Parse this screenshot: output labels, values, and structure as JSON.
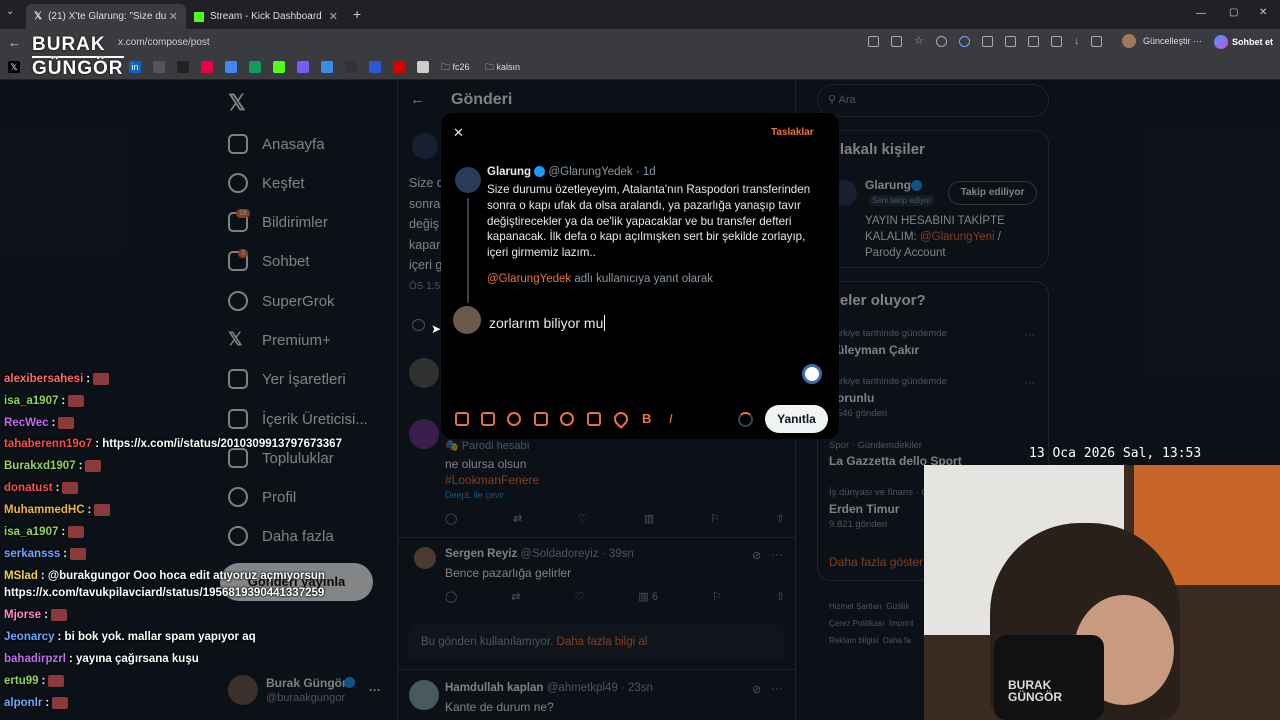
{
  "browser": {
    "tabs": [
      {
        "label": "(21) X'te Glarung: \"Size durumu öz",
        "close": "✕"
      },
      {
        "label": "Stream - Kick Dashboard",
        "close": "✕"
      }
    ],
    "new_tab": "+",
    "url": "x.com/compose/post",
    "update_btn": "Güncelleştir",
    "chat_btn": "Sohbet et",
    "bookmarks": [
      "fc26",
      "kalsın"
    ],
    "window_controls": [
      "—",
      "▢",
      "✕"
    ]
  },
  "overlay_logo": {
    "line1": "BURAK",
    "line2": "GÜNGÖR"
  },
  "x_nav": {
    "items": [
      {
        "label": "Anasayfa"
      },
      {
        "label": "Keşfet"
      },
      {
        "label": "Bildirimler",
        "badge": "18"
      },
      {
        "label": "Sohbet",
        "badge": "3"
      },
      {
        "label": "SuperGrok"
      },
      {
        "label": "Premium+"
      },
      {
        "label": "Yer İşaretleri"
      },
      {
        "label": "İçerik Üreticisi..."
      },
      {
        "label": "Topluluklar"
      },
      {
        "label": "Profil"
      },
      {
        "label": "Daha fazla"
      }
    ],
    "post_button": "Gönderi yayınla",
    "account": {
      "name": "Burak Güngör",
      "handle": "@buraakgungor",
      "more": "···"
    }
  },
  "feed": {
    "header": "Gönderi",
    "bg_text": [
      "Size d",
      "sonra",
      "değiş",
      "kapar",
      "içeri g"
    ],
    "time": "ÖS 1:5",
    "reply1": {
      "badge": "Parodi hesabı",
      "text": "ne olursa olsun",
      "hashtag": "#LookmanFenere",
      "translate": "DeepL ile çevir"
    },
    "reply2": {
      "name": "Sergen Reyiz",
      "handle": "@Soldadoreyiz",
      "time": "· 39sn",
      "text": "Bence pazarlığa gelirler",
      "views": "6"
    },
    "unavailable": "Bu gönderi kullanılamıyor.",
    "unavailable_link": "Daha fazla bilgi al",
    "reply3": {
      "name": "Hamdullah kaplan",
      "handle": "@ahmetkpl49",
      "time": "· 23sn",
      "text": "Kante de durum ne?"
    }
  },
  "modal": {
    "close": "✕",
    "drafts": "Taslaklar",
    "quoted": {
      "name": "Glarung",
      "handle": "@GlarungYedek",
      "time": "· 1d",
      "text": "Size durumu özetleyeyim, Atalanta'nın Raspodori transferinden sonra o kapı ufak da olsa aralandı, ya pazarlığa yanaşıp tavır değiştirecekler ya da oe'lik yapacaklar ve bu transfer defteri kapanacak. İlk defa o kapı açılmışken sert bir şekilde zorlayıp, içeri girmemiz lazım.."
    },
    "replying_to_handle": "@GlarungYedek",
    "replying_to_text": "adlı kullanıcıya yanıt olarak",
    "input_value": "zorlarım biliyor mu",
    "reply_button": "Yanıtla",
    "toolbar_icons": [
      "image-icon",
      "gif-icon",
      "grok-icon",
      "poll-icon",
      "emoji-icon",
      "schedule-icon",
      "location-icon",
      "bold-icon",
      "italic-icon"
    ],
    "toolbar_glyphs": {
      "bold": "B",
      "italic": "I"
    }
  },
  "right": {
    "search_placeholder": "Ara",
    "who_title": "Alakalı kişiler",
    "who": {
      "name": "Glarung",
      "follows_you": "Seni takip ediyor",
      "button": "Takip ediliyor",
      "bio1": "YAYIN HESABINI TAKİPTE",
      "bio2_pre": "KALALIM:",
      "bio2_link": "@GlarungYeni",
      "bio2_post": "/",
      "bio3": "Parody Account"
    },
    "trends_title": "Neler oluyor?",
    "trends": [
      {
        "ctx": "Türkiye tarihinde gündemde",
        "name": "Süleyman Çakır",
        "more": "···"
      },
      {
        "ctx": "Türkiye tarihinde gündemde",
        "name": "Sorunlu",
        "count": "1.546 gönderi",
        "more": "···"
      },
      {
        "ctx": "Spor · Gündemdekiler",
        "name": "La Gazzetta dello Sport"
      },
      {
        "ctx": "İş dünyası ve finans · Gündemde",
        "name": "Erden Timur",
        "count": "9.821 gönderi"
      }
    ],
    "show_more": "Daha fazla göster",
    "footer": [
      "Hizmet Şartları",
      "Gizlilik",
      "Çerez Politikası",
      "İmprint",
      "Reklam bilgisi",
      "Daha fa"
    ]
  },
  "chat": [
    {
      "user": "alexibersahesi",
      "color": "#ff6b6b",
      "msg": ":"
    },
    {
      "user": "isa_a1907",
      "color": "#8fd65a",
      "msg": ":"
    },
    {
      "user": "RecWec",
      "color": "#c56cf0",
      "msg": ":"
    },
    {
      "user": "tahaberenn19o7",
      "color": "#ff4d4d",
      "msg": ": https://x.com/i/status/2010309913797673367"
    },
    {
      "user": "Burakxd1907",
      "color": "#8fd65a",
      "msg": ":"
    },
    {
      "user": "donatust",
      "color": "#ff4d4d",
      "msg": ":"
    },
    {
      "user": "MuhammedHC",
      "color": "#f0b73a",
      "msg": ":"
    },
    {
      "user": "isa_a1907",
      "color": "#8fd65a",
      "msg": ":"
    },
    {
      "user": "serkansss",
      "color": "#6fa8ff",
      "msg": ":"
    },
    {
      "user": "MSlad",
      "color": "#f0d53a",
      "msg": ": @burakgungor Ooo hoca edit atıyoruz açmıyorsun"
    },
    {
      "user": "",
      "color": "#fff",
      "msg": "https://x.com/tavukpilavciard/status/1956819390441337259"
    },
    {
      "user": "Mjorse",
      "color": "#ff8ac9",
      "msg": ":"
    },
    {
      "user": "Jeonarcy",
      "color": "#6fa8ff",
      "msg": ": bi bok yok. mallar spam yapıyor aq"
    },
    {
      "user": "bahadirpzrl",
      "color": "#c56cf0",
      "msg": ": yayına çağırsana kuşu"
    },
    {
      "user": "ertu99",
      "color": "#8fd65a",
      "msg": ":"
    },
    {
      "user": "alponlr",
      "color": "#6fa8ff",
      "msg": ":"
    }
  ],
  "clock": "13 Oca 2026 Sal, 13:53",
  "colors": {
    "accent": "#e8743b",
    "x_bg": "#15202b",
    "modal_bg": "#000000"
  }
}
